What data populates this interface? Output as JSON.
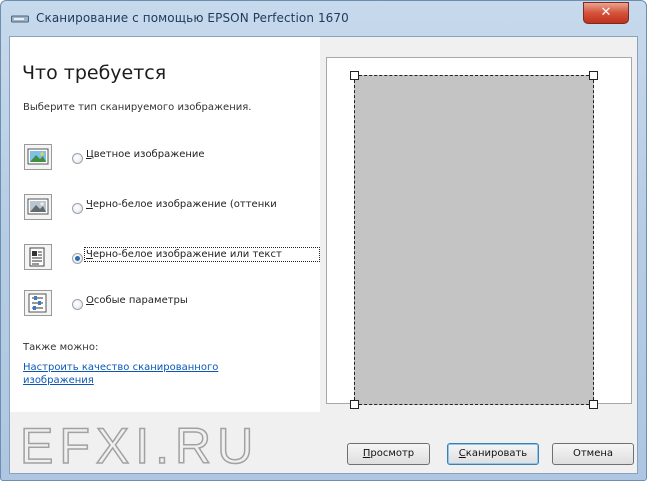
{
  "window": {
    "title": "Сканирование с помощью EPSON Perfection 1670",
    "close_label": "✕"
  },
  "left": {
    "heading": "Что требуется",
    "subheading": "Выберите тип сканируемого изображения.",
    "options": [
      {
        "icon": "color-photo-icon",
        "mnemonic": "Ц",
        "rest": "ветное изображение",
        "checked": false
      },
      {
        "icon": "grayscale-photo-icon",
        "mnemonic": "Ч",
        "rest": "ерно-белое изображение (оттенки",
        "checked": false
      },
      {
        "icon": "text-document-icon",
        "mnemonic": "Ч",
        "rest": "ерно-белое изображение или текст",
        "checked": true
      },
      {
        "icon": "custom-settings-icon",
        "mnemonic": "О",
        "rest": "собые параметры",
        "checked": false
      }
    ],
    "also_label": "Также можно:",
    "adjust_link": "Настроить качество сканированного изображения"
  },
  "watermark": "EFXI.RU",
  "buttons": {
    "preview": {
      "mnemonic": "П",
      "rest": "росмотр"
    },
    "scan": {
      "mnemonic": "С",
      "rest": "канировать"
    },
    "cancel": "Отмена"
  }
}
